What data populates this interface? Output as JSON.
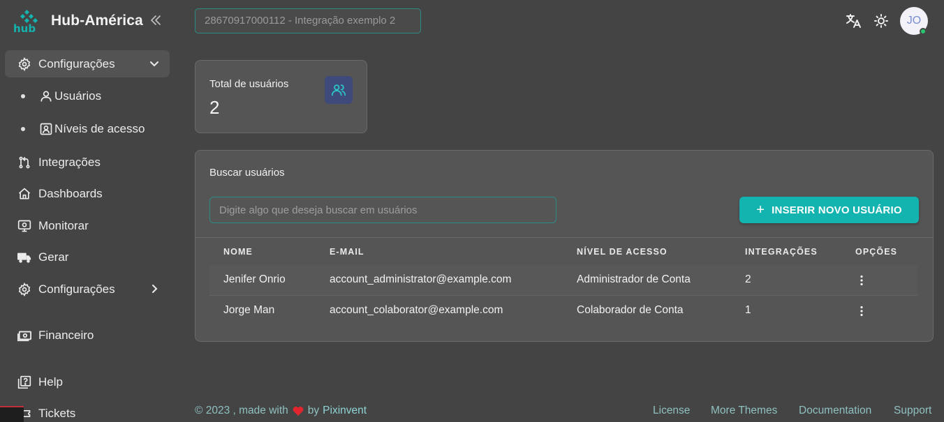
{
  "brand": {
    "name": "Hub-América",
    "logo_text": "hub",
    "accent": "#13b3b0"
  },
  "sidebar": {
    "items": [
      {
        "label": "Configurações",
        "icon": "gear-icon",
        "active": true,
        "expanded": true
      },
      {
        "label": "Usuários",
        "icon": "user-icon",
        "sub": true
      },
      {
        "label": "Níveis de acesso",
        "icon": "badge-icon",
        "sub": true
      },
      {
        "label": "Integrações",
        "icon": "git-pull-request-icon"
      },
      {
        "label": "Dashboards",
        "icon": "home-icon"
      },
      {
        "label": "Monitorar",
        "icon": "monitor-icon"
      },
      {
        "label": "Gerar",
        "icon": "truck-icon"
      },
      {
        "label": "Configurações",
        "icon": "gear-icon"
      },
      {
        "label": "Financeiro",
        "icon": "cash-icon"
      },
      {
        "label": "Help",
        "icon": "help-icon"
      },
      {
        "label": "Tickets",
        "icon": "ticket-icon"
      }
    ]
  },
  "header": {
    "company_value": "28670917000112 - Integração exemplo 2",
    "avatar_initials": "JO"
  },
  "stats": {
    "label": "Total de usuários",
    "value": "2"
  },
  "users_card": {
    "title": "Buscar usuários",
    "search_placeholder": "Digite algo que deseja buscar em usuários",
    "add_button_label": "INSERIR NOVO USUÁRIO",
    "columns": [
      "NOME",
      "E-MAIL",
      "NÍVEL DE ACESSO",
      "INTEGRAÇÕES",
      "OPÇÕES"
    ],
    "rows": [
      {
        "name": "Jenifer Onrio",
        "email": "account_administrator@example.com",
        "level": "Administrador de Conta",
        "integrations": "2"
      },
      {
        "name": "Jorge Man",
        "email": "account_colaborator@example.com",
        "level": "Colaborador de Conta",
        "integrations": "1"
      }
    ]
  },
  "footer": {
    "copyright": "© 2023 , made with",
    "by": "by",
    "author": "Pixinvent",
    "links": [
      "License",
      "More Themes",
      "Documentation",
      "Support"
    ]
  }
}
